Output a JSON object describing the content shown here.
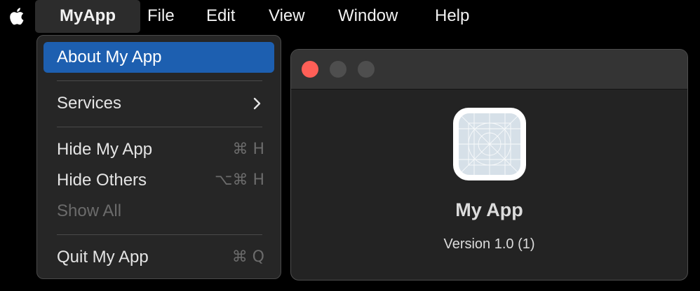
{
  "menubar": {
    "apple_icon": "apple-logo",
    "items": [
      {
        "label": "MyApp",
        "active": true
      },
      {
        "label": "File"
      },
      {
        "label": "Edit"
      },
      {
        "label": "View"
      },
      {
        "label": "Window"
      },
      {
        "label": "Help"
      }
    ]
  },
  "app_menu": {
    "items": [
      {
        "label": "About My App",
        "highlighted": true
      },
      {
        "label": "Services",
        "submenu_icon": "chevron-right"
      },
      {
        "label": "Hide My App",
        "shortcut": "⌘ H"
      },
      {
        "label": "Hide Others",
        "shortcut": "⌥⌘ H"
      },
      {
        "label": "Show All",
        "disabled": true
      },
      {
        "label": "Quit My App",
        "shortcut": "⌘ Q"
      }
    ]
  },
  "about_window": {
    "app_name": "My App",
    "version": "Version 1.0 (1)",
    "icon": "generic-app-icon"
  },
  "colors": {
    "highlight": "#1d5fb0",
    "close_button": "#ff5f57",
    "menu_background": "#262626",
    "window_background": "#232323"
  }
}
